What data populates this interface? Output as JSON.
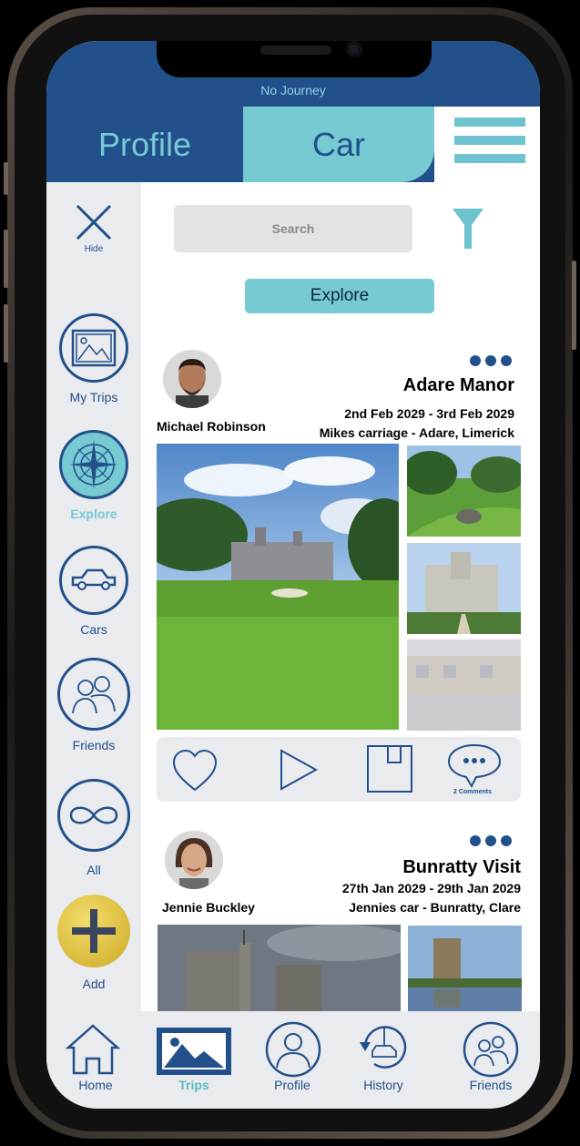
{
  "status": {
    "journey": "No Journey"
  },
  "header": {
    "tab_profile": "Profile",
    "tab_car": "Car",
    "menu_icon": "hamburger-menu-icon"
  },
  "sidebar": {
    "hide_label": "Hide",
    "items": [
      {
        "label": "My Trips",
        "icon": "photo-frame-icon"
      },
      {
        "label": "Explore",
        "icon": "compass-icon",
        "active": true
      },
      {
        "label": "Cars",
        "icon": "car-icon"
      },
      {
        "label": "Friends",
        "icon": "friends-icon"
      },
      {
        "label": "All",
        "icon": "infinity-icon"
      },
      {
        "label": "Add",
        "icon": "plus-icon"
      }
    ]
  },
  "search": {
    "placeholder": "Search",
    "filter_icon": "filter-icon"
  },
  "explore_button": "Explore",
  "posts": [
    {
      "user": "Michael Robinson",
      "title": "Adare Manor",
      "dates": "2nd Feb 2029 - 3rd Feb 2029",
      "car_location": "Mikes carriage - Adare, Limerick",
      "comments": "2 Comments"
    },
    {
      "user": "Jennie Buckley",
      "title": "Bunratty Visit",
      "dates": "27th Jan 2029 - 29th Jan 2029",
      "car_location": "Jennies car - Bunratty, Clare"
    }
  ],
  "bottom_nav": [
    {
      "label": "Home",
      "icon": "home-icon"
    },
    {
      "label": "Trips",
      "icon": "trips-image-icon",
      "active": true
    },
    {
      "label": "Profile",
      "icon": "profile-icon"
    },
    {
      "label": "History",
      "icon": "history-icon"
    },
    {
      "label": "Friends",
      "icon": "friends-icon"
    }
  ],
  "colors": {
    "primary": "#22508b",
    "accent": "#77c9d2",
    "panel": "#e9ebee"
  }
}
